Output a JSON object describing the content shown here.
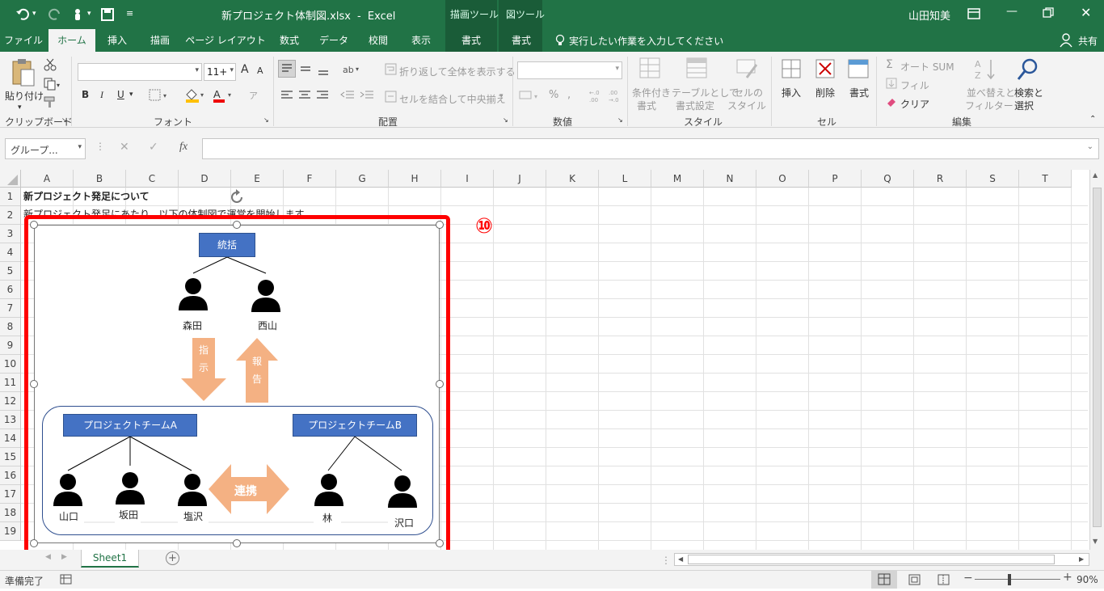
{
  "window": {
    "file_title": "新プロジェクト体制図.xlsx",
    "title_sep": "-",
    "app_name": "Excel",
    "context_tab_drawing": "描画ツール",
    "context_tab_picture": "図ツール",
    "user": "山田知美"
  },
  "tabs": [
    "ファイル",
    "ホーム",
    "挿入",
    "描画",
    "ページ レイアウト",
    "数式",
    "データ",
    "校閲",
    "表示",
    "書式",
    "書式"
  ],
  "tell_me": "実行したい作業を入力してください",
  "share": "共有",
  "ribbon": {
    "clipboard": {
      "paste": "貼り付け",
      "label": "クリップボード"
    },
    "font": {
      "name": "",
      "size": "11+",
      "label": "フォント",
      "bold": "B",
      "italic": "I",
      "underline": "U",
      "grow": "A",
      "shrink": "A"
    },
    "alignment": {
      "wrap": "折り返して全体を表示する",
      "merge": "セルを結合して中央揃え",
      "label": "配置"
    },
    "number": {
      "format": "",
      "label": "数値",
      "percent": "%"
    },
    "styles": {
      "conditional_1": "条件付き",
      "conditional_2": "書式",
      "table_1": "テーブルとして",
      "table_2": "書式設定",
      "cell_1": "セルの",
      "cell_2": "スタイル",
      "label": "スタイル"
    },
    "cells": {
      "insert": "挿入",
      "delete": "削除",
      "format": "書式",
      "label": "セル"
    },
    "editing": {
      "autosum": "オート SUM",
      "fill": "フィル",
      "clear": "クリア",
      "sort_1": "並べ替えと",
      "sort_2": "フィルター",
      "find_1": "検索と",
      "find_2": "選択",
      "label": "編集"
    }
  },
  "formula_bar": {
    "name_box": "グループ...",
    "fx": "fx",
    "value": ""
  },
  "columns": [
    "A",
    "B",
    "C",
    "D",
    "E",
    "F",
    "G",
    "H",
    "I",
    "J",
    "K",
    "L",
    "M",
    "N",
    "O",
    "P",
    "Q",
    "R",
    "S",
    "T"
  ],
  "rows": [
    "1",
    "2",
    "3",
    "4",
    "5",
    "6",
    "7",
    "8",
    "9",
    "10",
    "11",
    "12",
    "13",
    "14",
    "15",
    "16",
    "17",
    "18",
    "19"
  ],
  "cells": {
    "a1": "新プロジェクト発足について",
    "a2": "新プロジェクト発足にあたり、以下の体制図で運営を開始します。"
  },
  "diagram": {
    "top_box": "統括",
    "leader_left": "森田",
    "leader_right": "西山",
    "arrow_down": [
      "指",
      "示"
    ],
    "arrow_up": [
      "報",
      "告"
    ],
    "team_a": "プロジェクトチームA",
    "team_b": "プロジェクトチームB",
    "members_a": [
      "山口",
      "坂田",
      "塩沢"
    ],
    "members_b": [
      "林",
      "沢口"
    ],
    "link": "連携",
    "box_color": "#4472c4",
    "arrow_color": "#f4b183"
  },
  "annotation": {
    "number": "⑩",
    "color": "#ff0000"
  },
  "sheet_tab": "Sheet1",
  "status": {
    "ready": "準備完了",
    "zoom": "90%"
  }
}
